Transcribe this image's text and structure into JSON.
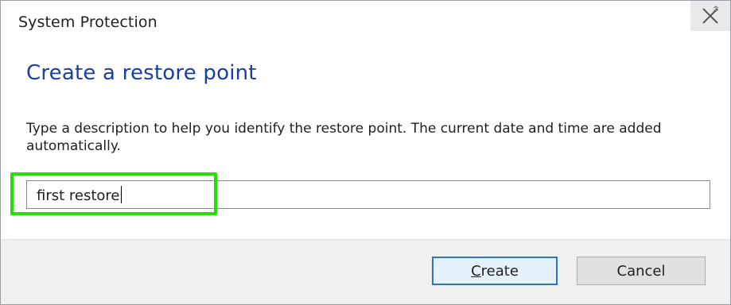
{
  "window": {
    "title": "System Protection"
  },
  "main": {
    "heading": "Create a restore point",
    "description": "Type a description to help you identify the restore point. The current date and time are added automatically.",
    "input_value": "first restore"
  },
  "buttons": {
    "create_label_accel": "C",
    "create_label_rest": "reate",
    "cancel_label": "Cancel"
  },
  "colors": {
    "heading": "#1b3f9e",
    "highlight": "#22e000",
    "default_button_border": "#2f73c9"
  },
  "icons": {
    "close": "close-icon"
  }
}
